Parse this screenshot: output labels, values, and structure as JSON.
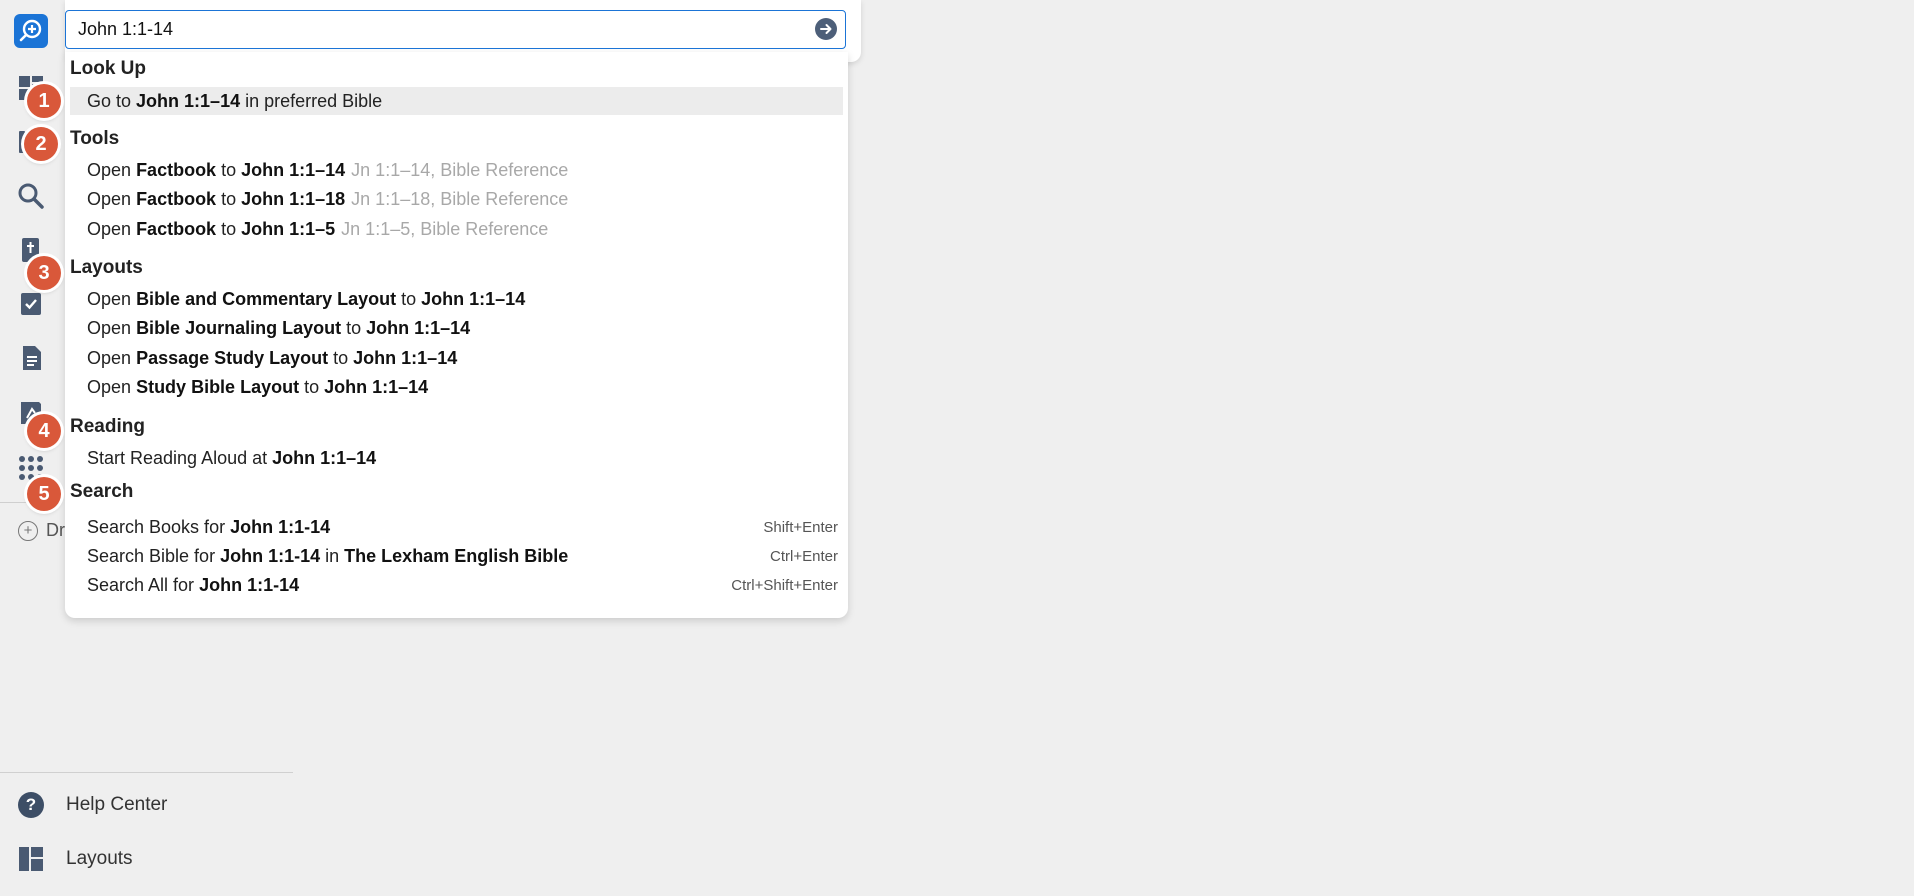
{
  "search": {
    "value": "John 1:1-14"
  },
  "badges": [
    "1",
    "2",
    "3",
    "4",
    "5"
  ],
  "sidebar": {
    "draft_label": "Dr",
    "bottom": [
      {
        "label": "Help Center",
        "icon": "help-icon"
      },
      {
        "label": "Layouts",
        "icon": "layouts-icon"
      }
    ]
  },
  "sections": {
    "lookup": {
      "title": "Look Up",
      "items": [
        {
          "pre": "Go to",
          "ref": "John 1:1–14",
          "post": "in preferred Bible"
        }
      ]
    },
    "tools": {
      "title": "Tools",
      "items": [
        {
          "pre": "Open",
          "name": "Factbook",
          "mid": "to",
          "ref": "John 1:1–14",
          "meta": "Jn 1:1–14, Bible Reference"
        },
        {
          "pre": "Open",
          "name": "Factbook",
          "mid": "to",
          "ref": "John 1:1–18",
          "meta": "Jn 1:1–18, Bible Reference"
        },
        {
          "pre": "Open",
          "name": "Factbook",
          "mid": "to",
          "ref": "John 1:1–5",
          "meta": "Jn 1:1–5, Bible Reference"
        }
      ]
    },
    "layouts": {
      "title": "Layouts",
      "items": [
        {
          "pre": "Open",
          "name": "Bible and Commentary Layout",
          "mid": "to",
          "ref": "John 1:1–14"
        },
        {
          "pre": "Open",
          "name": "Bible Journaling Layout",
          "mid": "to",
          "ref": "John 1:1–14"
        },
        {
          "pre": "Open",
          "name": "Passage Study Layout",
          "mid": "to",
          "ref": "John 1:1–14"
        },
        {
          "pre": "Open",
          "name": "Study Bible Layout",
          "mid": "to",
          "ref": "John 1:1–14"
        }
      ]
    },
    "reading": {
      "title": "Reading",
      "items": [
        {
          "pre": "Start Reading Aloud at",
          "ref": "John 1:1–14"
        }
      ]
    },
    "search": {
      "title": "Search",
      "items": [
        {
          "pre": "Search Books for",
          "ref": "John 1:1-14",
          "shortcut": "Shift+Enter"
        },
        {
          "pre": "Search Bible for",
          "ref": "John 1:1-14",
          "mid": "in",
          "name": "The Lexham English Bible",
          "shortcut": "Ctrl+Enter"
        },
        {
          "pre": "Search All for",
          "ref": "John 1:1-14",
          "shortcut": "Ctrl+Shift+Enter"
        }
      ]
    }
  }
}
